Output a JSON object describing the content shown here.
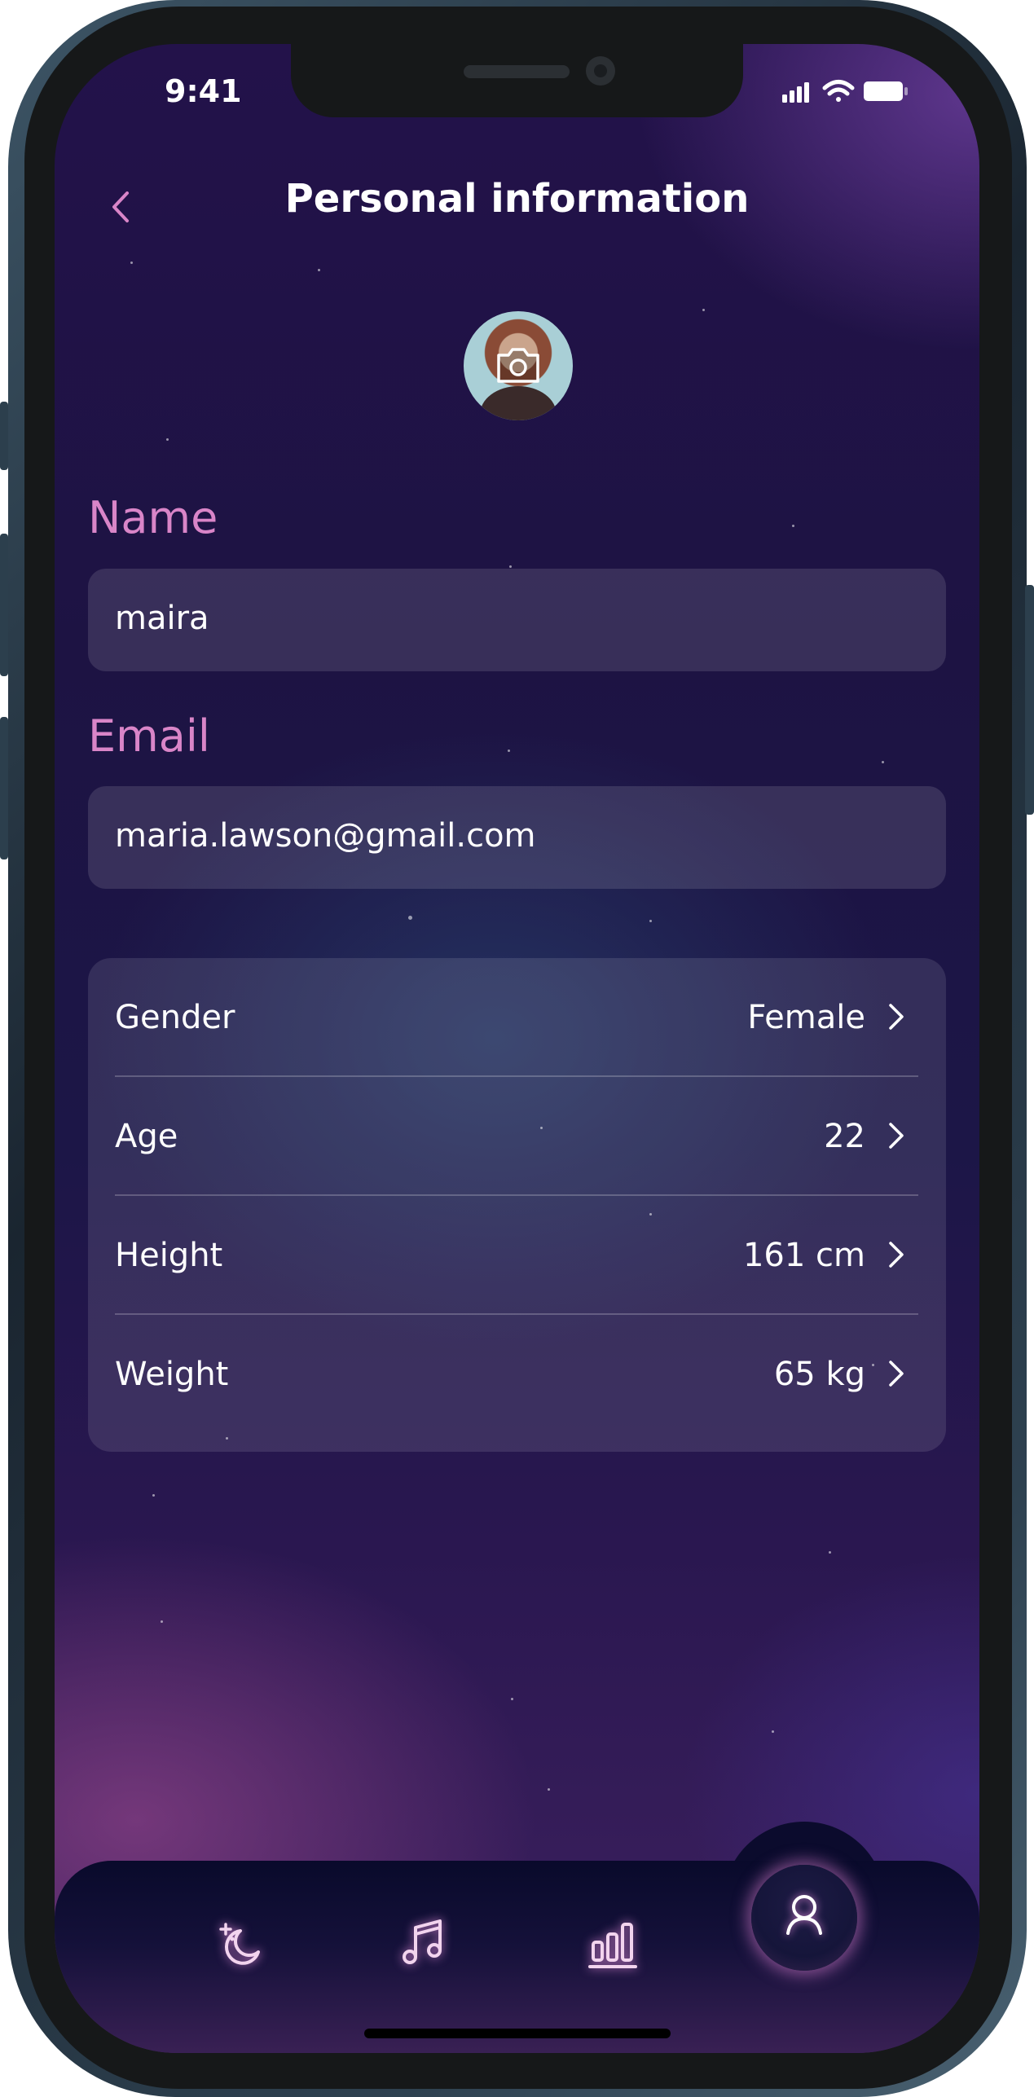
{
  "status_bar": {
    "time": "9:41"
  },
  "header": {
    "title": "Personal information"
  },
  "form": {
    "name": {
      "label": "Name",
      "value": "maira"
    },
    "email": {
      "label": "Email",
      "value": "maria.lawson@gmail.com"
    }
  },
  "details": [
    {
      "label": "Gender",
      "value": "Female"
    },
    {
      "label": "Age",
      "value": "22"
    },
    {
      "label": "Height",
      "value": "161 cm"
    },
    {
      "label": "Weight",
      "value": "65 kg"
    }
  ],
  "tabbar": {
    "items": [
      {
        "icon": "moon-stars-icon",
        "active": false
      },
      {
        "icon": "music-note-icon",
        "active": false
      },
      {
        "icon": "bar-chart-icon",
        "active": false
      },
      {
        "icon": "user-icon",
        "active": true
      }
    ]
  },
  "colors": {
    "accent_pink": "#d985c8",
    "text": "#ffffff",
    "field_bg": "rgba(255,255,255,0.12)"
  }
}
